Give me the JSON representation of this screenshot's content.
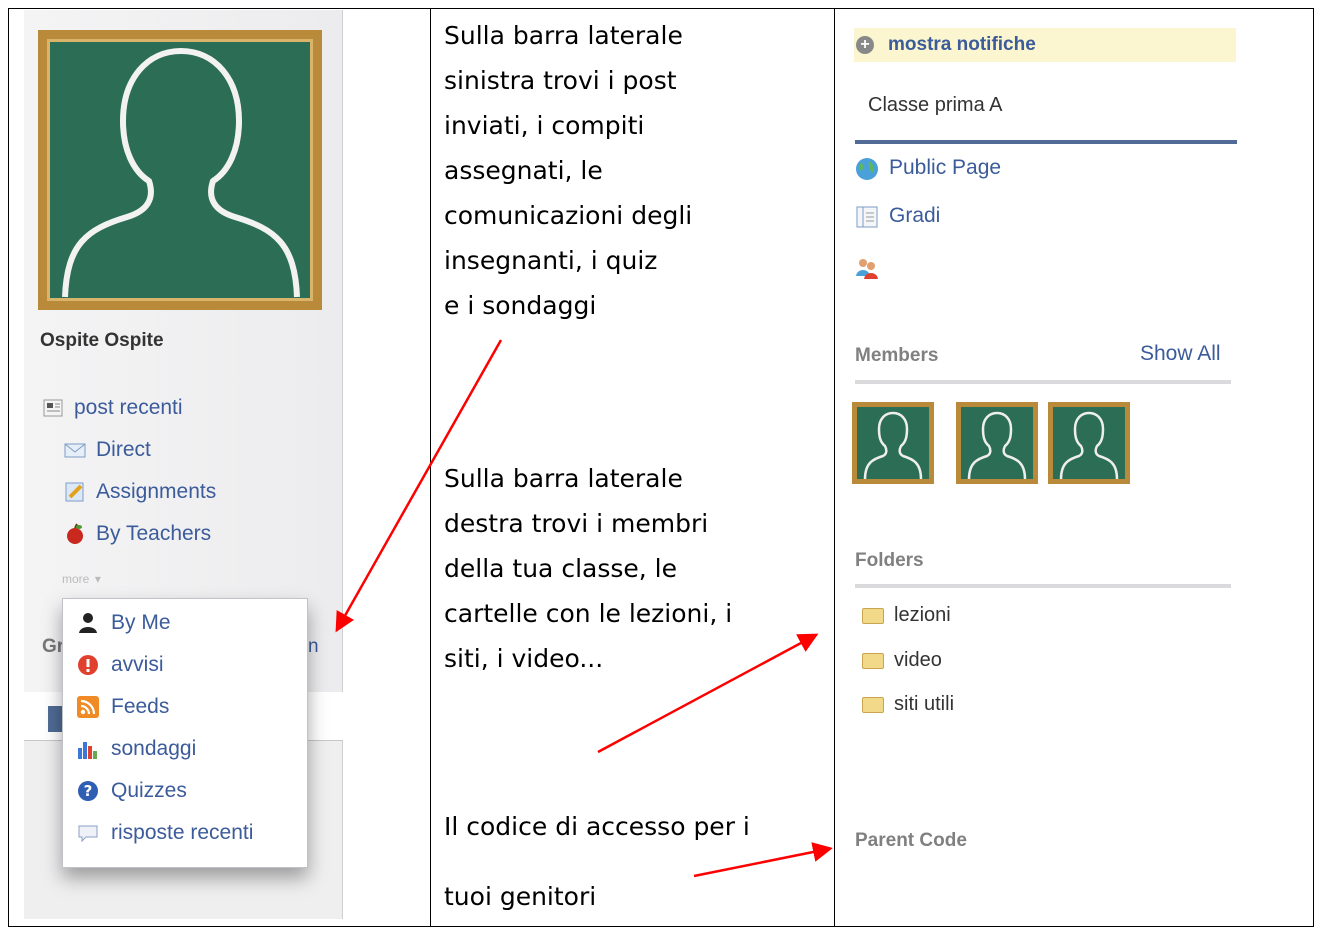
{
  "left_panel": {
    "user_name": "Ospite Ospite",
    "nav": [
      "post recenti",
      "Direct",
      "Assignments",
      "By Teachers"
    ],
    "more_label": "more",
    "more_arrow": "▾",
    "group_fragment_left": "Gr",
    "group_fragment_right": "n",
    "dropdown": [
      "By Me",
      "avvisi",
      "Feeds",
      "sondaggi",
      "Quizzes",
      "risposte recenti"
    ]
  },
  "middle_text": {
    "block1": [
      "Sulla barra laterale",
      "sinistra trovi i post",
      "inviati, i compiti",
      "assegnati, le",
      "comunicazioni degli",
      "insegnanti, i quiz",
      "e i sondaggi"
    ],
    "block2": [
      "Sulla barra laterale",
      "destra trovi i membri",
      "della tua classe, le",
      "cartelle con le lezioni, i",
      "siti, i video..."
    ],
    "block3": [
      "Il codice di accesso per i",
      "tuoi genitori"
    ]
  },
  "right_panel": {
    "notif_label": "mostra notifiche",
    "class_name": "Classe prima A",
    "links": [
      "Public Page",
      "Gradi"
    ],
    "members_title": "Members",
    "show_all": "Show All",
    "folders_title": "Folders",
    "folders": [
      "lezioni",
      "video",
      "siti utili"
    ],
    "parent_code_title": "Parent Code"
  },
  "colors": {
    "link": "#3b5b9a",
    "chalkboard": "#2c6e55",
    "frame_wood": "#b88a3a",
    "arrow": "#ff0000"
  }
}
